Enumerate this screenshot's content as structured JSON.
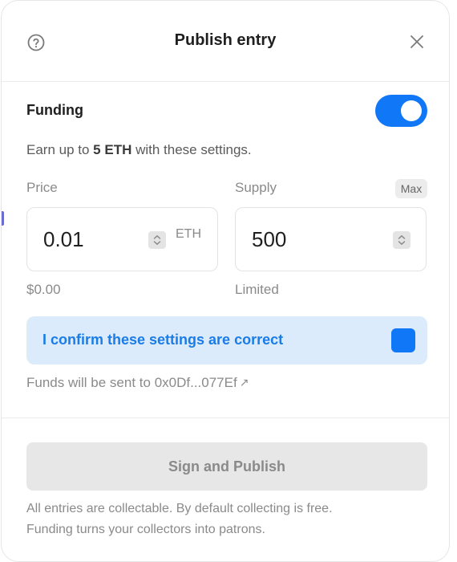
{
  "header": {
    "title": "Publish entry",
    "help_icon": "question-circle-icon",
    "close_icon": "close-icon"
  },
  "funding": {
    "label": "Funding",
    "toggle_on": true,
    "earn_prefix": "Earn up to ",
    "earn_amount": "5 ETH",
    "earn_suffix": " with these settings."
  },
  "price": {
    "label": "Price",
    "value": "0.01",
    "unit": "ETH",
    "usd": "$0.00"
  },
  "supply": {
    "label": "Supply",
    "max_label": "Max",
    "value": "500",
    "limit_label": "Limited"
  },
  "confirm": {
    "label": "I confirm these settings are correct",
    "checked": true
  },
  "funds": {
    "text": "Funds will be sent to 0x0Df...077Ef",
    "link_icon": "external-link-arrow-icon"
  },
  "publish": {
    "label": "Sign and Publish"
  },
  "footer": {
    "line1": "All entries are collectable. By default collecting is free.",
    "line2": "Funding turns your collectors into patrons."
  },
  "colors": {
    "accent": "#1077f7",
    "confirm_bg": "#dbebfb",
    "confirm_text": "#1a7ce6",
    "muted_text": "#8a8a8a",
    "disabled_button": "#e7e7e7"
  }
}
